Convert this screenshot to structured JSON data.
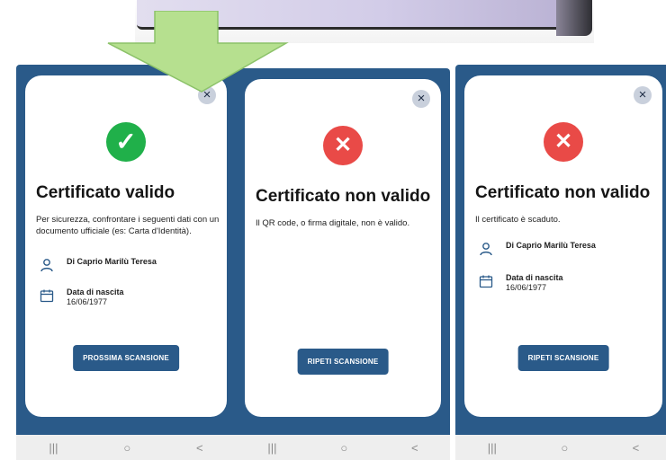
{
  "colors": {
    "frame": "#2a5a89",
    "valid_green": "#20b04a",
    "invalid_red": "#e94a47",
    "arrow_green": "#b6e08f",
    "nav_bar": "#eeeeee"
  },
  "decor": {
    "arrow_icon": "arrow-down-icon"
  },
  "screens": [
    {
      "status_icon": "check-icon",
      "status_glyph": "✓",
      "title": "Certificato valido",
      "description": "Per sicurezza, confrontare i seguenti dati con un documento ufficiale (es: Carta d'Identità).",
      "person_name": "Di Caprio Marilù Teresa",
      "birth_label": "Data di nascita",
      "birth_date": "16/06/1977",
      "button_label": "PROSSIMA SCANSIONE",
      "close_glyph": "×",
      "nav": {
        "recent": "|||",
        "home": "○",
        "back": "<"
      }
    },
    {
      "status_icon": "x-icon",
      "status_glyph": "✕",
      "title": "Certificato non valido",
      "description": "Il QR code, o firma digitale, non è valido.",
      "button_label": "RIPETI SCANSIONE",
      "close_glyph": "×",
      "nav": {
        "recent": "|||",
        "home": "○",
        "back": "<"
      }
    },
    {
      "status_icon": "x-icon",
      "status_glyph": "✕",
      "title": "Certificato non valido",
      "description": "Il certificato è scaduto.",
      "person_name": "Di Caprio Marilù Teresa",
      "birth_label": "Data di nascita",
      "birth_date": "16/06/1977",
      "button_label": "RIPETI SCANSIONE",
      "close_glyph": "×",
      "nav": {
        "recent": "|||",
        "home": "○",
        "back": "<"
      }
    }
  ]
}
